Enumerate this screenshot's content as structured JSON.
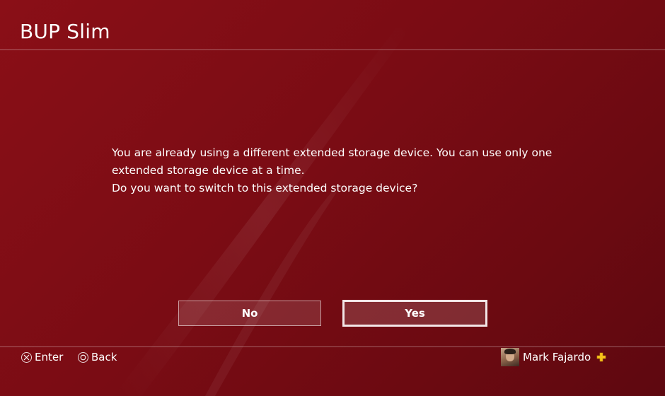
{
  "screen": {
    "title": "BUP Slim"
  },
  "dialog": {
    "message_line1": "You are already using a different extended storage device. You can use only one extended storage device at a time.",
    "message_line2": "Do you want to switch to this extended storage device?",
    "no_label": "No",
    "yes_label": "Yes",
    "focused_button": "Yes"
  },
  "footer": {
    "enter_label": "Enter",
    "back_label": "Back",
    "enter_icon": "cross-button-icon",
    "back_icon": "circle-button-icon",
    "user_name": "Mark Fajardo",
    "plus_icon": "playstation-plus-icon"
  },
  "colors": {
    "background": "#7a0c14",
    "plus_gold": "#f6c21a"
  }
}
